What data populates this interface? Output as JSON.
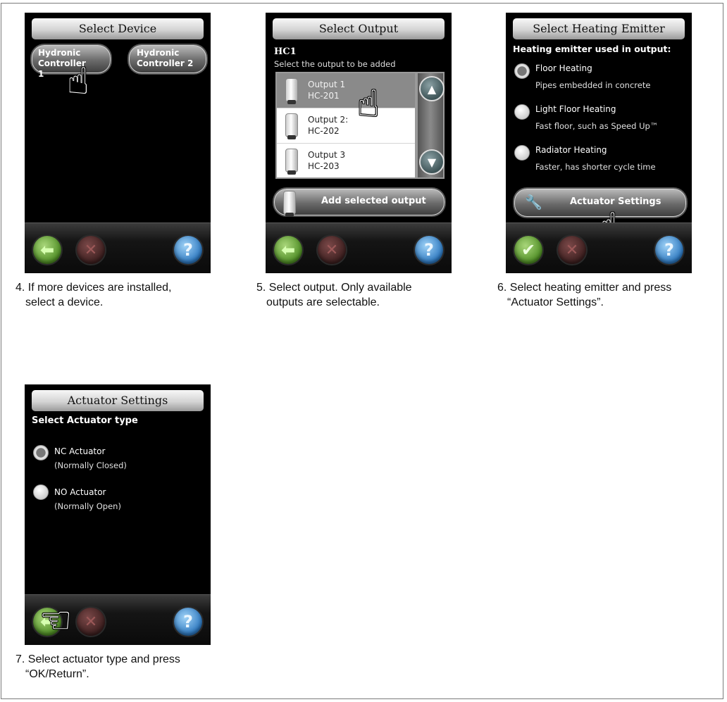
{
  "screens": {
    "select_device": {
      "title": "Select Device",
      "buttons": [
        "Hydronic Controller 1",
        "Hydronic Controller 2"
      ],
      "caption_line1": "4. If more devices are installed,",
      "caption_line2": "select a device."
    },
    "select_output": {
      "title": "Select Output",
      "header": "HC1",
      "subheader": "Select the output to be added",
      "items": [
        {
          "line1": "Output 1",
          "line2": "HC-201"
        },
        {
          "line1": "Output 2:",
          "line2": "HC-202"
        },
        {
          "line1": "Output 3",
          "line2": "HC-203"
        }
      ],
      "add_button": "Add selected output",
      "caption_line1": "5. Select output. Only available",
      "caption_line2": "outputs are selectable."
    },
    "select_emitter": {
      "title": "Select Heating Emitter",
      "header": "Heating emitter used in output:",
      "options": [
        {
          "title": "Floor Heating",
          "sub": "Pipes embedded in concrete"
        },
        {
          "title": "Light Floor Heating",
          "sub": "Fast floor, such as Speed Up™"
        },
        {
          "title": "Radiator Heating",
          "sub": "Faster, has shorter cycle time"
        }
      ],
      "settings_button": "Actuator Settings",
      "caption_line1": "6. Select heating emitter and press",
      "caption_line2": "“Actuator Settings”."
    },
    "actuator_settings": {
      "title": "Actuator Settings",
      "header": "Select Actuator type",
      "options": [
        {
          "title": "NC Actuator",
          "sub": "(Normally Closed)"
        },
        {
          "title": "NO Actuator",
          "sub": "(Normally Open)"
        }
      ],
      "caption_line1": "7. Select actuator type and press",
      "caption_line2": "“OK/Return”."
    }
  },
  "nav_icons": {
    "back": "arrow-left-icon",
    "cancel": "x-icon",
    "help": "question-icon",
    "ok": "check-icon"
  },
  "colors": {
    "title_bar": "#d4d4d4",
    "back_green": "#4f8e25",
    "help_blue": "#2d78c0",
    "cancel_red": "#3e2020"
  }
}
